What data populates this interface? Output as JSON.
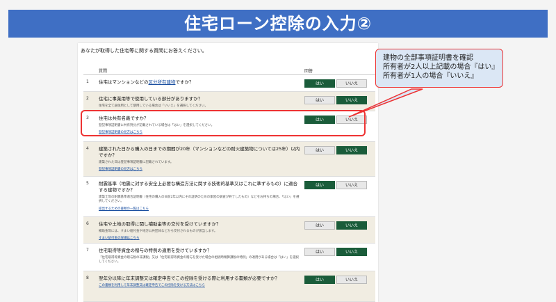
{
  "banner": {
    "title": "住宅ローン控除の入力②"
  },
  "form": {
    "intro": "あなたが取得した住宅等に関する質問にお答えください。",
    "col_question": "質問",
    "col_answer": "回答",
    "yes_label": "はい",
    "no_label": "いいえ",
    "rows": [
      {
        "num": "1",
        "pre": "住宅はマンションなどの",
        "link": "区分所有建物",
        "post": "ですか？",
        "note": "",
        "lk": "",
        "answer": "yes"
      },
      {
        "num": "2",
        "pre": "住宅に事業用等で使用している部分がありますか？",
        "link": "",
        "post": "",
        "note": "住宅を全て居住用として使用している場合は「いいえ」を選択してください。",
        "lk": "",
        "answer": "no"
      },
      {
        "num": "3",
        "pre": "住宅は共有名義ですか？",
        "link": "",
        "post": "",
        "note": "登記事項証明書に共有持分が記載されている場合は「はい」を選択してください。",
        "lk": "登記事項証明書の見方はこちら",
        "answer": "yes"
      },
      {
        "num": "4",
        "pre": "建築された日から購入の日までの期間が20年（マンションなどの耐火建築物については25年）以内ですか？",
        "link": "",
        "post": "",
        "note": "建築された日は登記事項証明書に記載されています。",
        "lk": "登記事項証明書の見方はこちら",
        "answer": "no"
      },
      {
        "num": "5",
        "pre": "耐震基準（地震に対する安全上必要な構造方法に関する技術的基準又はこれに準ずるもの）に適合する建物ですか？",
        "link": "",
        "post": "",
        "note": "建築士等の耐震基準適合証明書（住宅の購入の日前2年以内にその証明のための家屋の調査が終了したもの）などをお持ちの場合、「はい」を選択してください。",
        "lk": "提出するための書類の一覧はこちら",
        "answer": "yes"
      },
      {
        "num": "6",
        "pre": "住宅や土地の取得に関し補助金等の交付を受けていますか？",
        "link": "",
        "post": "",
        "note": "補助金等には、すまい給付金や地方公共団体などから交付されるものが該当します。",
        "lk": "すまい給付金の詳細はこちら",
        "answer": "no"
      },
      {
        "num": "7",
        "pre": "住宅取得等資金の贈与の特例の適用を受けていますか？",
        "link": "",
        "post": "",
        "note": "「住宅取得等資金の贈与税の非課税」又は「住宅取得等資金の贈与を受けた場合の相続時精算課税の特例」の適用がある場合は「はい」を選択してください。",
        "lk": "",
        "answer": "no"
      },
      {
        "num": "8",
        "pre": "翌年分以降に年末調整又は確定申告でこの控除を受ける際に利用する書類が必要ですか？",
        "link": "",
        "post": "",
        "note": "",
        "lk": "この書類を利用して年末調整又は確定申告でこの控除を受ける方法はこちら",
        "answer": "yes"
      }
    ]
  },
  "callout": {
    "line1": "建物の全部事項証明書を確認",
    "line2": "所有者が2人以上記載の場合『はい』",
    "line3": "所有者が1人の場合『いいえ』"
  },
  "colors": {
    "banner": "#3f6fc4",
    "selected": "#1a5c3a",
    "highlight": "#e33333",
    "callout_bg": "#dbe7f5"
  }
}
